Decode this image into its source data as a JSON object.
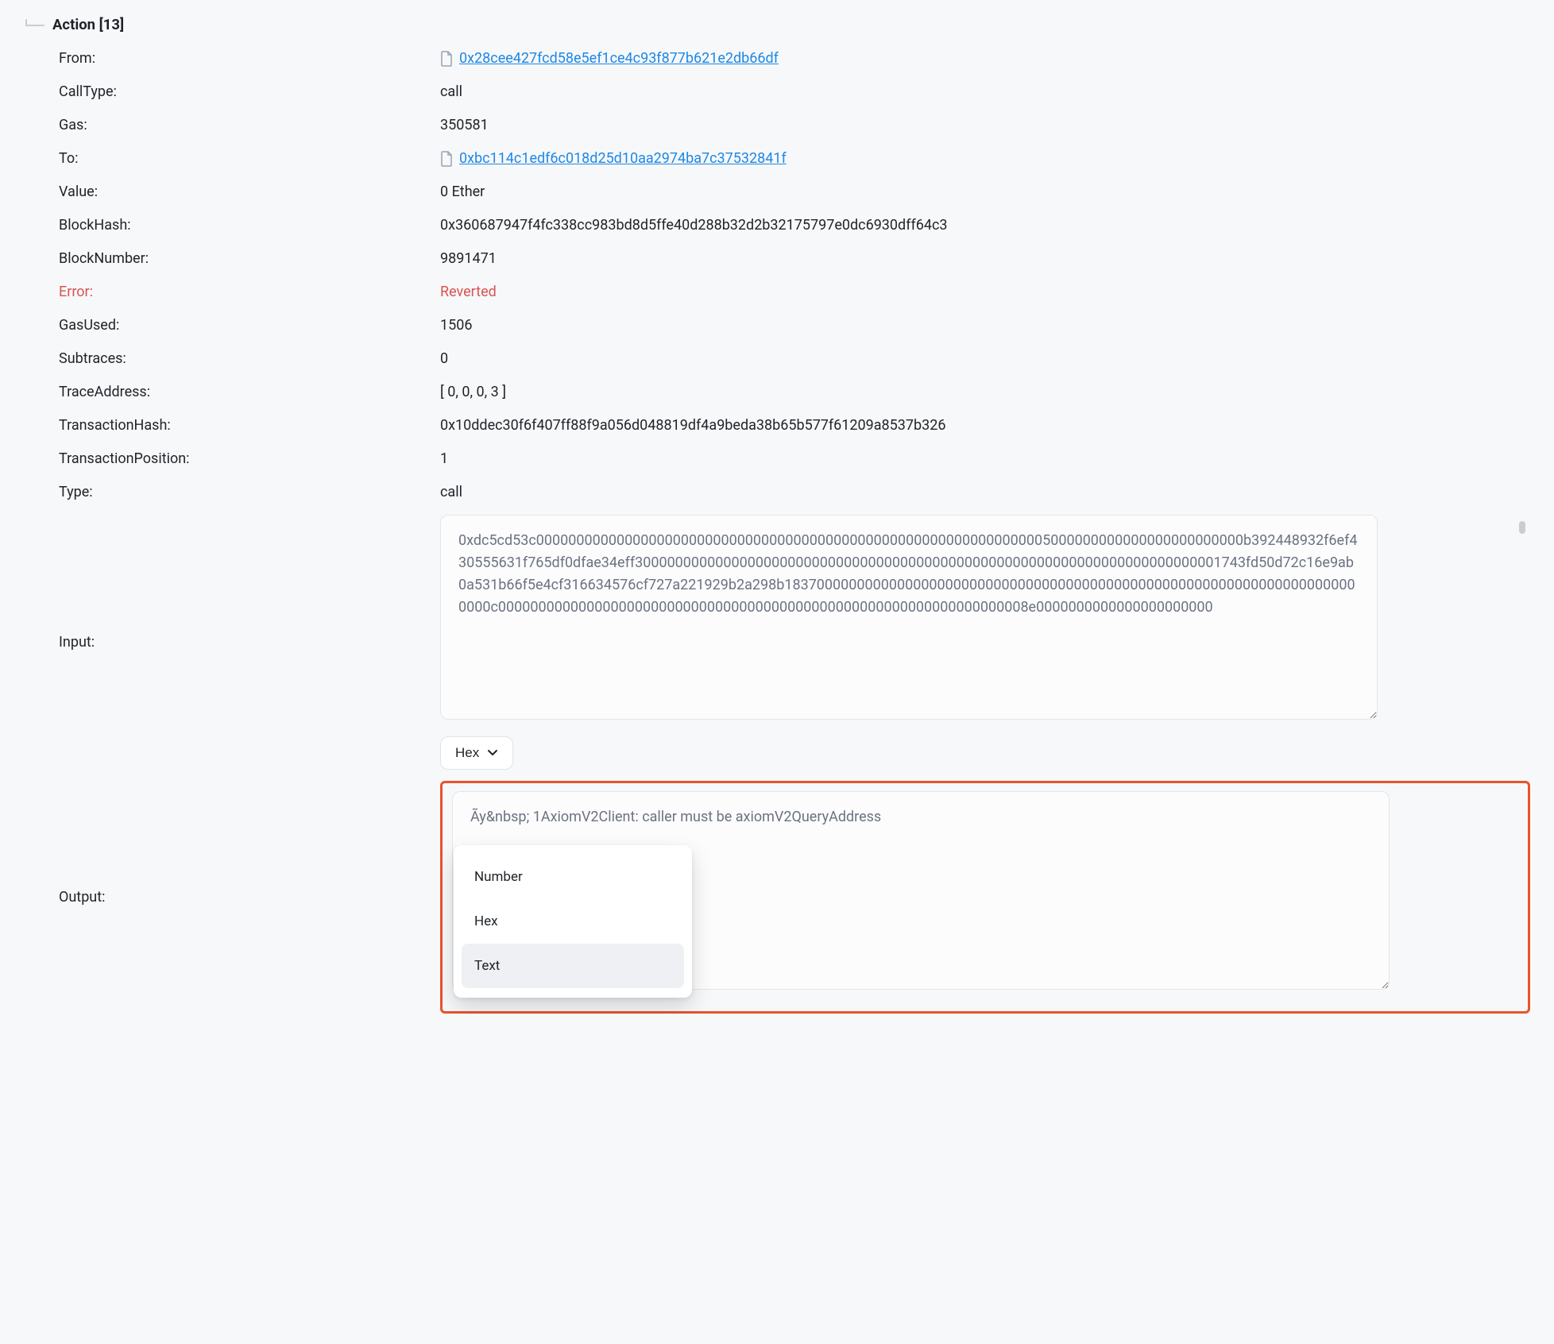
{
  "section": {
    "title": "Action [13]"
  },
  "rows": {
    "from_label": "From:",
    "from_value": "0x28cee427fcd58e5ef1ce4c93f877b621e2db66df",
    "calltype_label": "CallType:",
    "calltype_value": "call",
    "gas_label": "Gas:",
    "gas_value": "350581",
    "to_label": "To:",
    "to_value": "0xbc114c1edf6c018d25d10aa2974ba7c37532841f",
    "value_label": "Value:",
    "value_value": "0 Ether",
    "blockhash_label": "BlockHash:",
    "blockhash_value": "0x360687947f4fc338cc983bd8d5ffe40d288b32d2b32175797e0dc6930dff64c3",
    "blocknumber_label": "BlockNumber:",
    "blocknumber_value": "9891471",
    "error_label": "Error:",
    "error_value": "Reverted",
    "gasused_label": "GasUsed:",
    "gasused_value": "1506",
    "subtraces_label": "Subtraces:",
    "subtraces_value": "0",
    "traceaddress_label": "TraceAddress:",
    "traceaddress_value": "[ 0, 0, 0, 3 ]",
    "txhash_label": "TransactionHash:",
    "txhash_value": "0x10ddec30f6f407ff88f9a056d048819df4a9beda38b65b577f61209a8537b326",
    "txpos_label": "TransactionPosition:",
    "txpos_value": "1",
    "type_label": "Type:",
    "type_value": "call",
    "input_label": "Input:",
    "input_value": "0xdc5cd53c0000000000000000000000000000000000000000000000000000000000000005000000000000000000000000b392448932f6ef430555631f765df0dfae34eff3000000000000000000000000000000000000000000000000000000000000000000000001743fd50d72c16e9ab0a531b66f5e4cf316634576cf727a221929b2a298b183700000000000000000000000000000000000000000000000000000000000000000000000c000000000000000000000000000000000000000000000000000000000000000008e0000000000000000000000",
    "input_format": "Hex",
    "output_label": "Output:",
    "output_value": "Ãy&nbsp; 1AxiomV2Client: caller must be axiomV2QueryAddress",
    "output_menu": {
      "opt1": "Number",
      "opt2": "Hex",
      "opt3": "Text"
    }
  }
}
